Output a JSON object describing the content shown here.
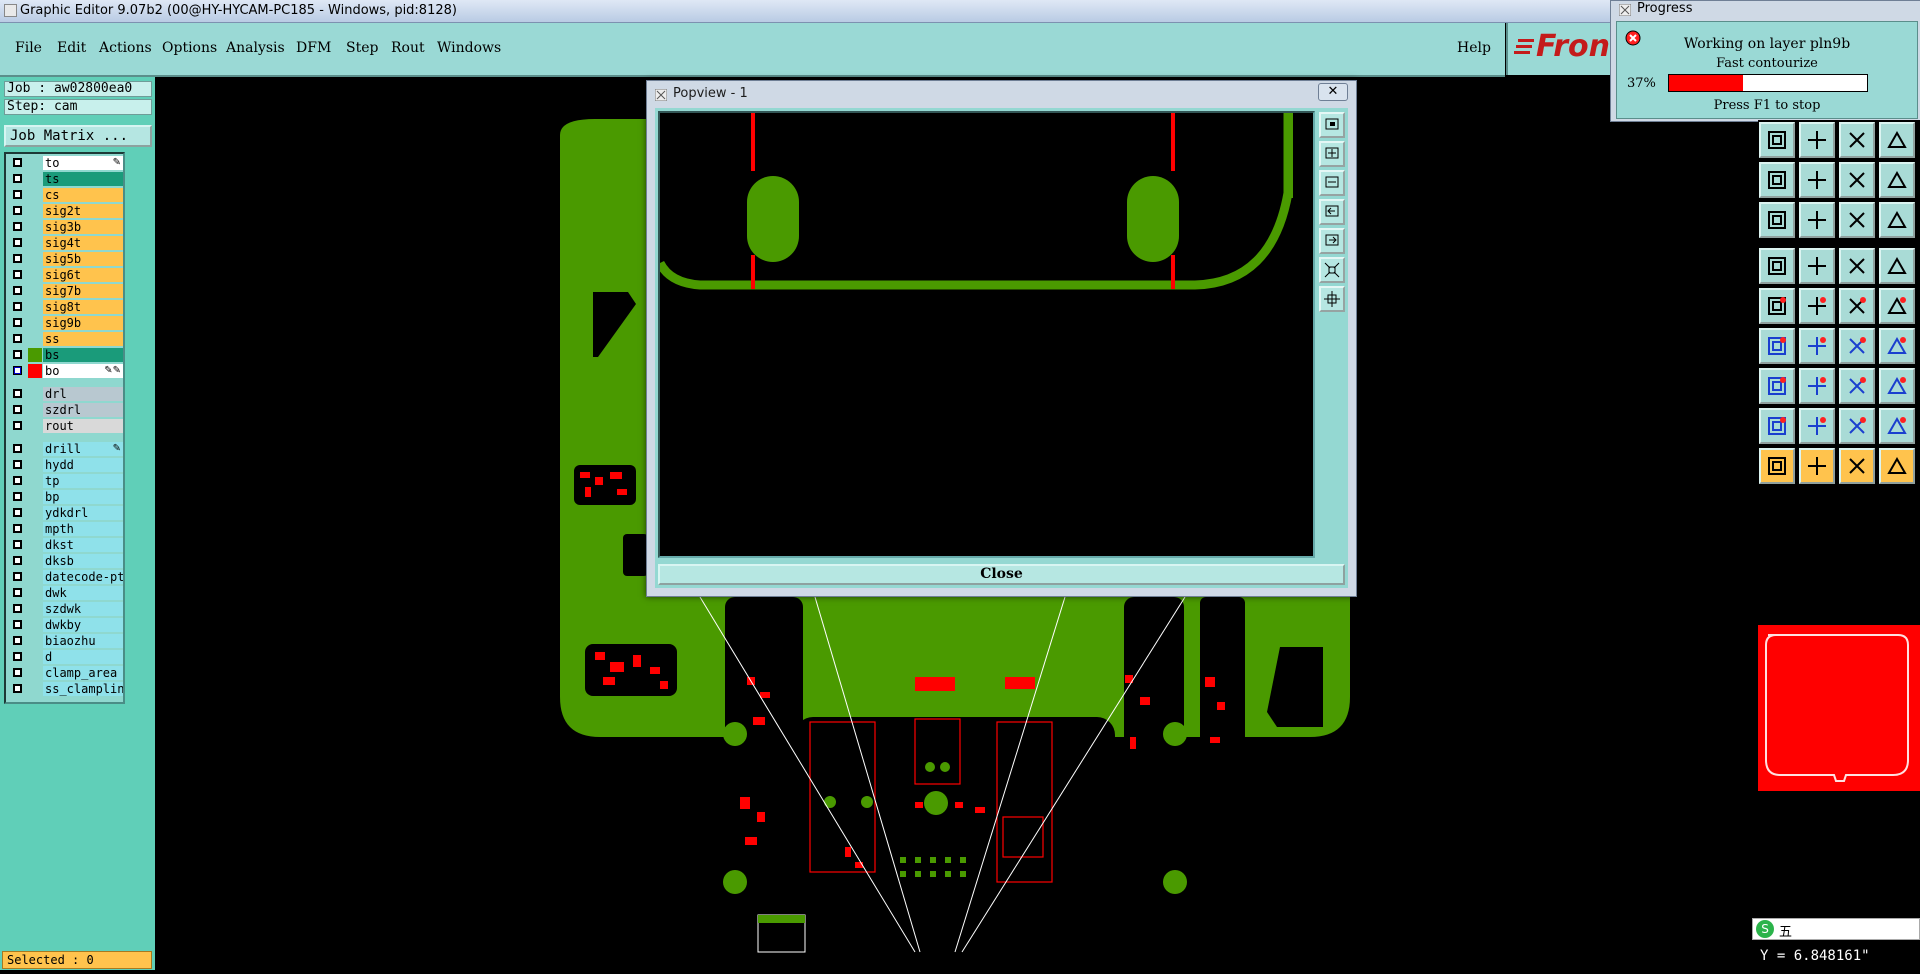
{
  "window": {
    "title": "Graphic Editor 9.07b2 (00@HY-HYCAM-PC185 - Windows, pid:8128)"
  },
  "menu": {
    "items": [
      "File",
      "Edit",
      "Actions",
      "Options",
      "Analysis",
      "DFM",
      "Step",
      "Rout",
      "Windows"
    ],
    "help": "Help"
  },
  "logo": "Front",
  "job": {
    "job_line": "Job : aw02800ea0",
    "step_line": "Step: cam",
    "matrix_button": "Job Matrix ..."
  },
  "layers": [
    {
      "name": "to",
      "color": "#ffffff",
      "flag": "✎"
    },
    {
      "name": "ts",
      "color": "#1a9b7a"
    },
    {
      "name": "cs",
      "color": "#ffc34d"
    },
    {
      "name": "sig2t",
      "color": "#ffc34d"
    },
    {
      "name": "sig3b",
      "color": "#ffc34d"
    },
    {
      "name": "sig4t",
      "color": "#ffc34d"
    },
    {
      "name": "sig5b",
      "color": "#ffc34d"
    },
    {
      "name": "sig6t",
      "color": "#ffc34d"
    },
    {
      "name": "sig7b",
      "color": "#ffc34d"
    },
    {
      "name": "sig8t",
      "color": "#ffc34d"
    },
    {
      "name": "sig9b",
      "color": "#ffc34d"
    },
    {
      "name": "ss",
      "color": "#ffc34d"
    },
    {
      "name": "bs",
      "color": "#1a9b7a"
    },
    {
      "name": "bo",
      "color": "#ffffff",
      "flag": "✎✎"
    },
    {
      "name": "drl",
      "color": "#b8c8d0"
    },
    {
      "name": "szdrl",
      "color": "#b8c8d0"
    },
    {
      "name": "rout",
      "color": "#d9d9d9"
    },
    {
      "name": "drill",
      "color": "#8fe1ea",
      "flag": "✎"
    },
    {
      "name": "hydd",
      "color": "#8fe1ea"
    },
    {
      "name": "tp",
      "color": "#8fe1ea"
    },
    {
      "name": "bp",
      "color": "#8fe1ea"
    },
    {
      "name": "ydkdrl",
      "color": "#8fe1ea"
    },
    {
      "name": "mpth",
      "color": "#8fe1ea"
    },
    {
      "name": "dkst",
      "color": "#8fe1ea"
    },
    {
      "name": "dksb",
      "color": "#8fe1ea"
    },
    {
      "name": "datecode-pto",
      "color": "#8fe1ea"
    },
    {
      "name": "dwk",
      "color": "#8fe1ea"
    },
    {
      "name": "szdwk",
      "color": "#8fe1ea"
    },
    {
      "name": "dwkby",
      "color": "#8fe1ea"
    },
    {
      "name": "biaozhu",
      "color": "#8fe1ea"
    },
    {
      "name": "d",
      "color": "#8fe1ea"
    },
    {
      "name": "clamp_area",
      "color": "#8fe1ea"
    },
    {
      "name": "ss_clampline",
      "color": "#8fe1ea"
    }
  ],
  "status": {
    "selected": "Selected : 0"
  },
  "popview": {
    "title": "Popview - 1",
    "close_x": "✕",
    "close_button": "Close"
  },
  "progress": {
    "title": "Progress",
    "line1": "Working on layer pln9b",
    "line2": "Fast contourize",
    "percent_text": "37%",
    "percent": 37,
    "line3": "Press F1 to stop"
  },
  "coords": {
    "y": "Y = 6.848161\""
  },
  "ime": "五",
  "colors": {
    "board": "#4a9a00",
    "pad": "#ff0000",
    "panel": "#60cfb8",
    "menu": "#9ad9d5"
  }
}
